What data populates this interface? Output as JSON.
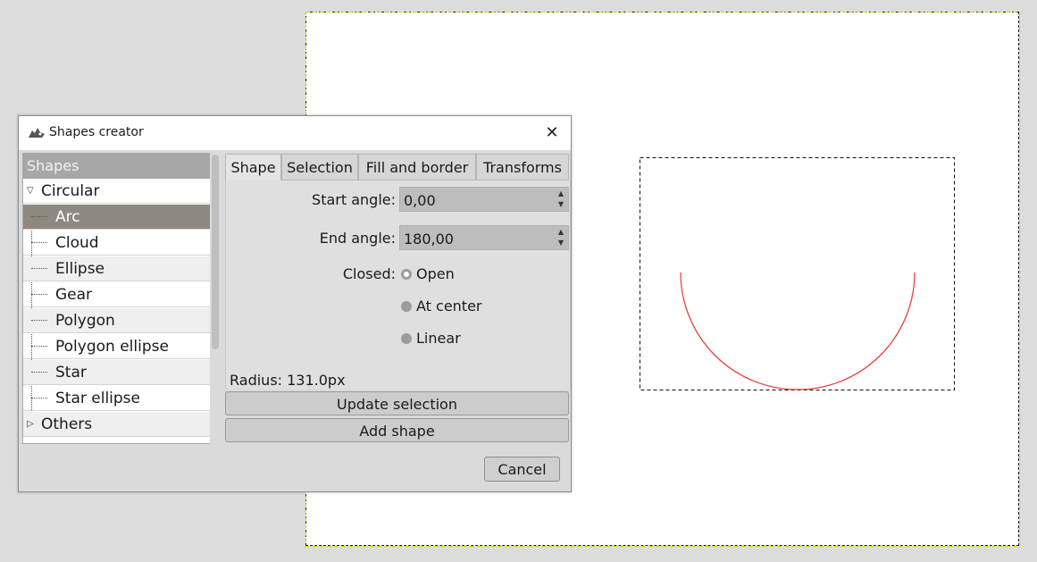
{
  "dialog": {
    "title": "Shapes creator",
    "close_glyph": "✕",
    "icon": "gimp-wilber-icon"
  },
  "tree": {
    "header": "Shapes",
    "groups": [
      {
        "label": "Circular",
        "expanded": true
      },
      {
        "label": "Others",
        "expanded": false
      }
    ],
    "items": [
      "Arc",
      "Cloud",
      "Ellipse",
      "Gear",
      "Polygon",
      "Polygon ellipse",
      "Star",
      "Star ellipse"
    ],
    "selected": "Arc"
  },
  "tabs": [
    "Shape",
    "Selection",
    "Fill and border",
    "Transforms"
  ],
  "active_tab": "Shape",
  "form": {
    "start_angle_label": "Start angle:",
    "start_angle_value": "0,00",
    "end_angle_label": "End angle:",
    "end_angle_value": "180,00",
    "closed_label": "Closed:",
    "closed_options": [
      "Open",
      "At center",
      "Linear"
    ],
    "closed_selected": "Open",
    "radius_text": "Radius: 131.0px"
  },
  "buttons": {
    "update_selection": "Update selection",
    "add_shape": "Add shape",
    "cancel": "Cancel"
  },
  "colors": {
    "arc_stroke": "#e8403a",
    "selection_accent": "#f0e000"
  }
}
